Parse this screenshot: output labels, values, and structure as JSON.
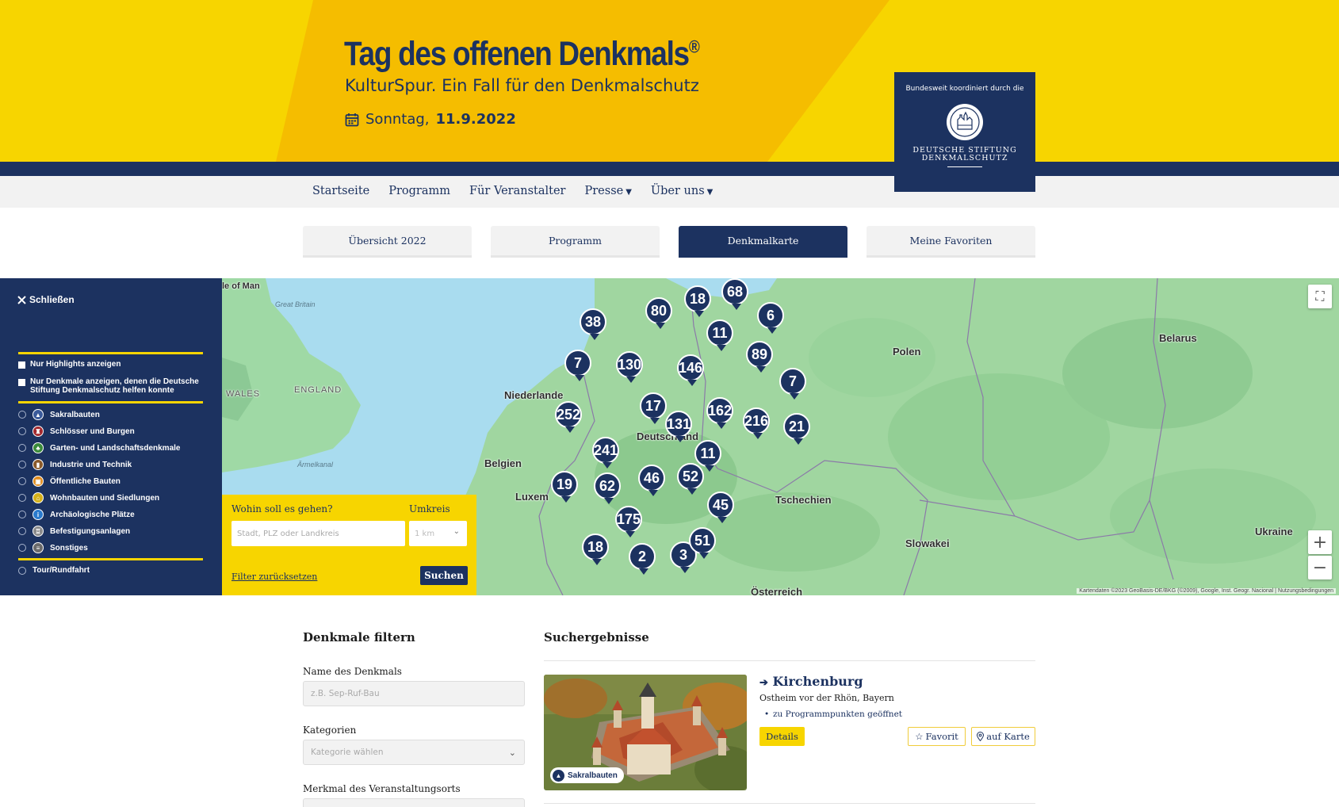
{
  "banner": {
    "title": "Tag des offenen Denkmals",
    "registered": "®",
    "subtitle": "KulturSpur. Ein Fall für den Denkmalschutz",
    "date_prefix": "Sonntag,",
    "date_value": "11.9.2022",
    "colors": {
      "yellow": "#f7d500",
      "orange": "#f5bd00",
      "navy": "#1c3260"
    }
  },
  "logo": {
    "coordinated_by": "Bundesweit koordiniert durch die",
    "org_line1": "DEUTSCHE STIFTUNG",
    "org_line2": "DENKMALSCHUTZ"
  },
  "nav": {
    "items": [
      "Startseite",
      "Programm",
      "Für Veranstalter",
      "Presse",
      "Über uns"
    ]
  },
  "tabs": [
    {
      "label": "Übersicht 2022",
      "active": false
    },
    {
      "label": "Programm",
      "active": false
    },
    {
      "label": "Denkmalkarte",
      "active": true
    },
    {
      "label": "Meine Favoriten",
      "active": false
    }
  ],
  "sidebar": {
    "close_label": "Schließen",
    "checkboxes": [
      "Nur Highlights anzeigen",
      "Nur Denkmale anzeigen, denen die Deutsche Stiftung Denkmalschutz helfen konnte"
    ],
    "categories": [
      {
        "label": "Sakralbauten",
        "icon": "church-icon",
        "color": "#3a5a9a"
      },
      {
        "label": "Schlösser und Burgen",
        "icon": "castle-icon",
        "color": "#a3282e"
      },
      {
        "label": "Garten- und Landschaftsdenkmale",
        "icon": "tree-icon",
        "color": "#3a8a3a"
      },
      {
        "label": "Industrie und Technik",
        "icon": "factory-icon",
        "color": "#8a5a2a"
      },
      {
        "label": "Öffentliche Bauten",
        "icon": "building-icon",
        "color": "#e08a1a"
      },
      {
        "label": "Wohnbauten und Siedlungen",
        "icon": "house-icon",
        "color": "#d4b01a"
      },
      {
        "label": "Archäologische Plätze",
        "icon": "info-icon",
        "color": "#2a7acc"
      },
      {
        "label": "Befestigungsanlagen",
        "icon": "fortress-icon",
        "color": "#8a8a8a"
      },
      {
        "label": "Sonstiges",
        "icon": "misc-icon",
        "color": "#6a6a6a"
      }
    ],
    "tour_label": "Tour/Rundfahrt"
  },
  "map": {
    "labels": [
      "le of Man",
      "Great Britain",
      "WALES",
      "ENGLAND",
      "Ärmelkanal",
      "Niederlande",
      "Belgien",
      "Luxem",
      "Deutschland",
      "Polen",
      "Belarus",
      "Tschechien",
      "Slowakei",
      "Ukraine",
      "Österreich"
    ],
    "markers": [
      "38",
      "80",
      "18",
      "68",
      "6",
      "11",
      "7",
      "130",
      "146",
      "89",
      "7",
      "252",
      "17",
      "131",
      "162",
      "216",
      "21",
      "241",
      "11",
      "19",
      "62",
      "46",
      "52",
      "45",
      "175",
      "18",
      "2",
      "3",
      "51"
    ],
    "attribution": "Kartendaten ©2023 GeoBasis-DE/BKG (©2009), Google, Inst. Geogr. Nacional  |  Nutzungsbedingungen"
  },
  "search": {
    "where_label": "Wohin soll es gehen?",
    "where_placeholder": "Stadt, PLZ oder Landkreis",
    "radius_label": "Umkreis",
    "radius_value": "1 km",
    "reset_label": "Filter zurücksetzen",
    "submit_label": "Suchen"
  },
  "filter": {
    "heading": "Denkmale filtern",
    "name_label": "Name des Denkmals",
    "name_placeholder": "z.B. Sep-Ruf-Bau",
    "category_label": "Kategorien",
    "category_placeholder": "Kategorie wählen",
    "feature_label": "Merkmal des Veranstaltungsorts"
  },
  "results": {
    "heading": "Suchergebnisse",
    "items": [
      {
        "title": "Kirchenburg",
        "location": "Ostheim vor der Rhön, Bayern",
        "opening": "zu Programmpunkten geöffnet",
        "category": "Sakralbauten",
        "details_label": "Details",
        "favorite_label": "Favorit",
        "map_label": "auf Karte"
      }
    ]
  }
}
